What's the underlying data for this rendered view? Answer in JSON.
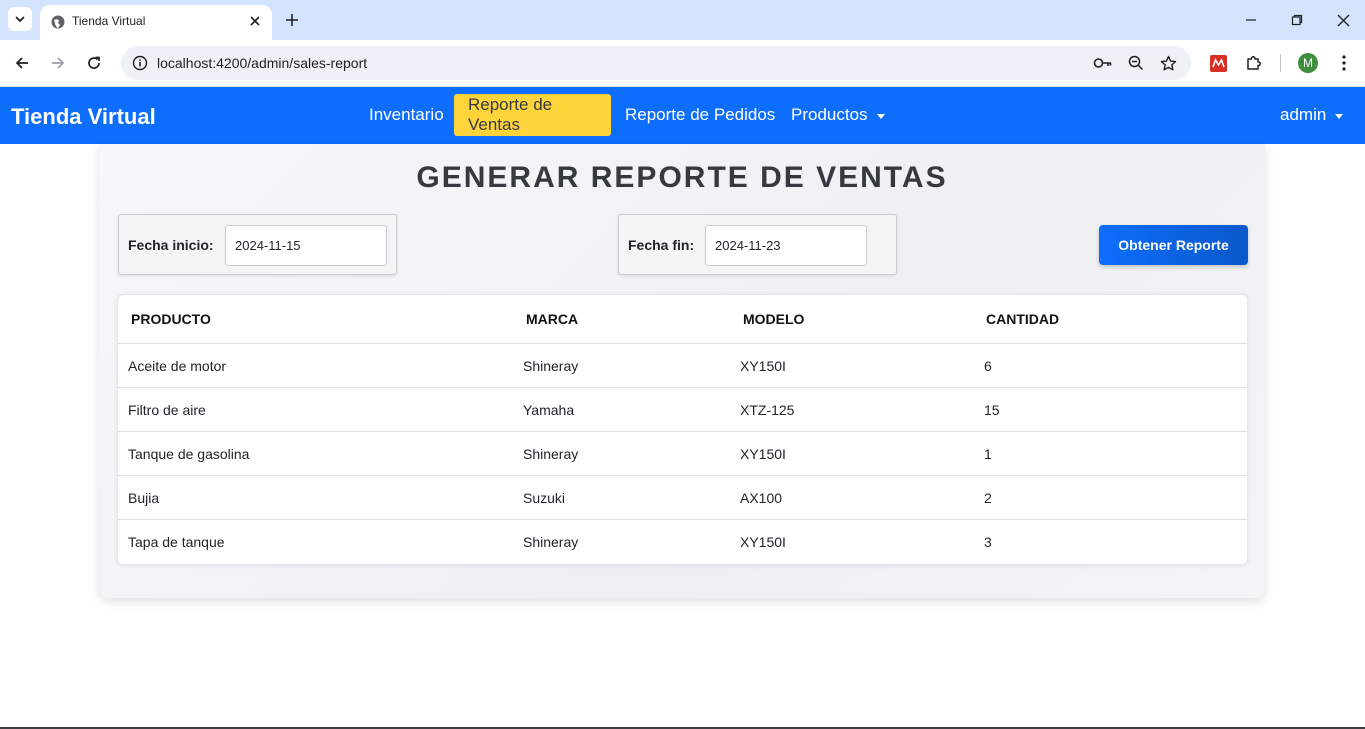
{
  "browser": {
    "tab_title": "Tienda Virtual",
    "url": "localhost:4200/admin/sales-report",
    "profile_initial": "M"
  },
  "navbar": {
    "brand": "Tienda Virtual",
    "links": [
      {
        "label": "Inventario"
      },
      {
        "label": "Reporte de Ventas",
        "active": true
      },
      {
        "label": "Reporte de Pedidos"
      },
      {
        "label": "Productos"
      }
    ],
    "user": "admin",
    "colors": {
      "bg": "#0d6efd",
      "active_bg": "#ffd43b"
    }
  },
  "report": {
    "title": "GENERAR REPORTE DE VENTAS",
    "start_label": "Fecha inicio:",
    "start_value": "2024-11-15",
    "end_label": "Fecha fin:",
    "end_value": "2024-11-23",
    "button_label": "Obtener Reporte"
  },
  "table": {
    "headers": [
      "PRODUCTO",
      "MARCA",
      "MODELO",
      "CANTIDAD"
    ],
    "rows": [
      [
        "Aceite de motor",
        "Shineray",
        "XY150I",
        "6"
      ],
      [
        "Filtro de aire",
        "Yamaha",
        "XTZ-125",
        "15"
      ],
      [
        "Tanque de gasolina",
        "Shineray",
        "XY150I",
        "1"
      ],
      [
        "Bujia",
        "Suzuki",
        "AX100",
        "2"
      ],
      [
        "Tapa de tanque",
        "Shineray",
        "XY150I",
        "3"
      ]
    ]
  }
}
